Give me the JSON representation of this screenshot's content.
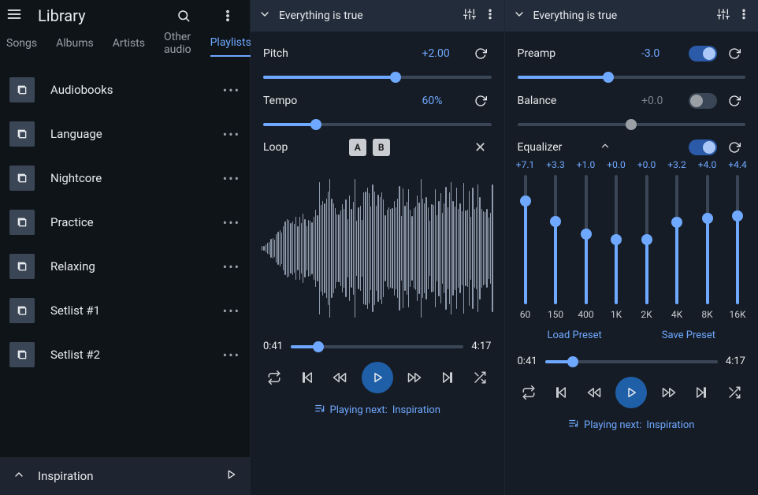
{
  "sidebar": {
    "title": "Library",
    "tabs": [
      "Songs",
      "Albums",
      "Artists",
      "Other audio",
      "Playlists"
    ],
    "active_tab_index": 4,
    "playlists": [
      {
        "name": "Audiobooks"
      },
      {
        "name": "Language"
      },
      {
        "name": "Nightcore"
      },
      {
        "name": "Practice"
      },
      {
        "name": "Relaxing"
      },
      {
        "name": "Setlist #1"
      },
      {
        "name": "Setlist #2"
      }
    ],
    "footer_title": "Inspiration"
  },
  "panel_left": {
    "track": {
      "title": "Everything is true"
    },
    "pitch": {
      "label": "Pitch",
      "value_text": "+2.00",
      "percent": 58
    },
    "tempo": {
      "label": "Tempo",
      "value_text": "60%",
      "percent": 23
    },
    "loop": {
      "label": "Loop",
      "a_label": "A",
      "b_label": "B"
    },
    "progress": {
      "current": "0:41",
      "total": "4:17",
      "percent": 16
    },
    "next": {
      "prefix": "Playing next:",
      "title": "Inspiration"
    }
  },
  "panel_right": {
    "track": {
      "title": "Everything is true"
    },
    "preamp": {
      "label": "Preamp",
      "value_text": "-3.0",
      "on": true,
      "percent": 40
    },
    "balance": {
      "label": "Balance",
      "value_text": "+0.0",
      "on": false,
      "percent": 50
    },
    "equalizer": {
      "label": "Equalizer",
      "on": true
    },
    "eq_bands": [
      {
        "freq": "60",
        "value": "+7.1"
      },
      {
        "freq": "150",
        "value": "+3.3"
      },
      {
        "freq": "400",
        "value": "+1.0"
      },
      {
        "freq": "1K",
        "value": "+0.0"
      },
      {
        "freq": "2K",
        "value": "+0.0"
      },
      {
        "freq": "4K",
        "value": "+3.2"
      },
      {
        "freq": "8K",
        "value": "+4.0"
      },
      {
        "freq": "16K",
        "value": "+4.4"
      }
    ],
    "preset": {
      "load": "Load Preset",
      "save": "Save Preset"
    },
    "progress": {
      "current": "0:41",
      "total": "4:17",
      "percent": 16
    },
    "next": {
      "prefix": "Playing next:",
      "title": "Inspiration"
    }
  }
}
